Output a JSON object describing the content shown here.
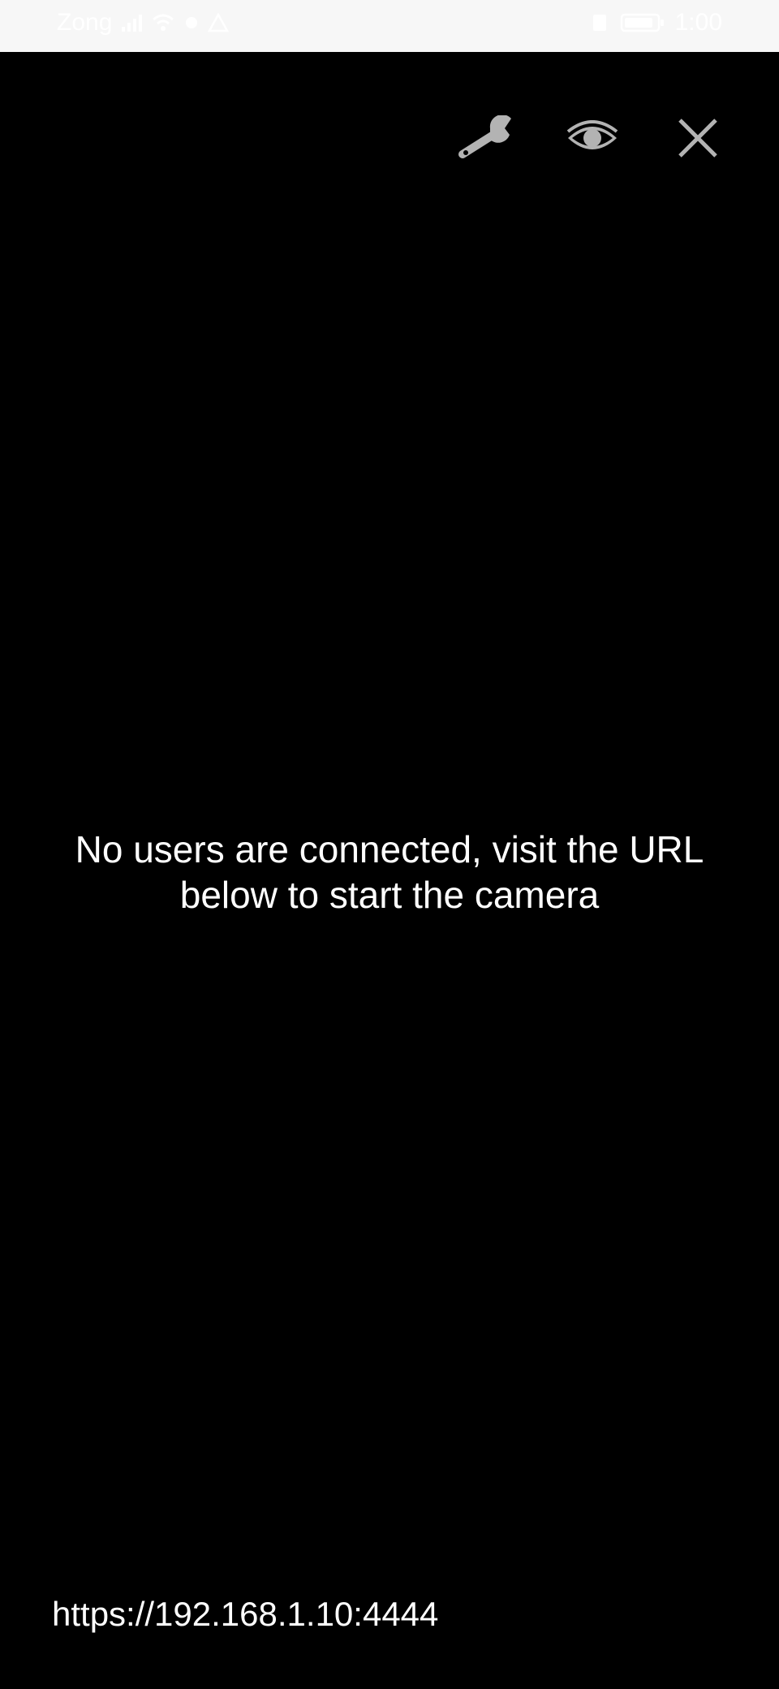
{
  "status_bar": {
    "carrier": "Zong",
    "signal_icon": "signal-icon",
    "wifi_icon": "wifi-icon",
    "notification_icons": [
      "dot-icon",
      "warning-icon"
    ],
    "battery_icon": "battery-icon",
    "time": "1:00"
  },
  "toolbar": {
    "settings_icon": "wrench-icon",
    "preview_icon": "eye-icon",
    "close_icon": "close-icon",
    "icon_color": "#b3b3b3"
  },
  "main": {
    "message": "No users are connected, visit the URL below to start the camera"
  },
  "footer": {
    "url": "https://192.168.1.10:4444"
  },
  "colors": {
    "background": "#000000",
    "status_bar_bg": "#f7f7f7",
    "text": "#ffffff"
  }
}
